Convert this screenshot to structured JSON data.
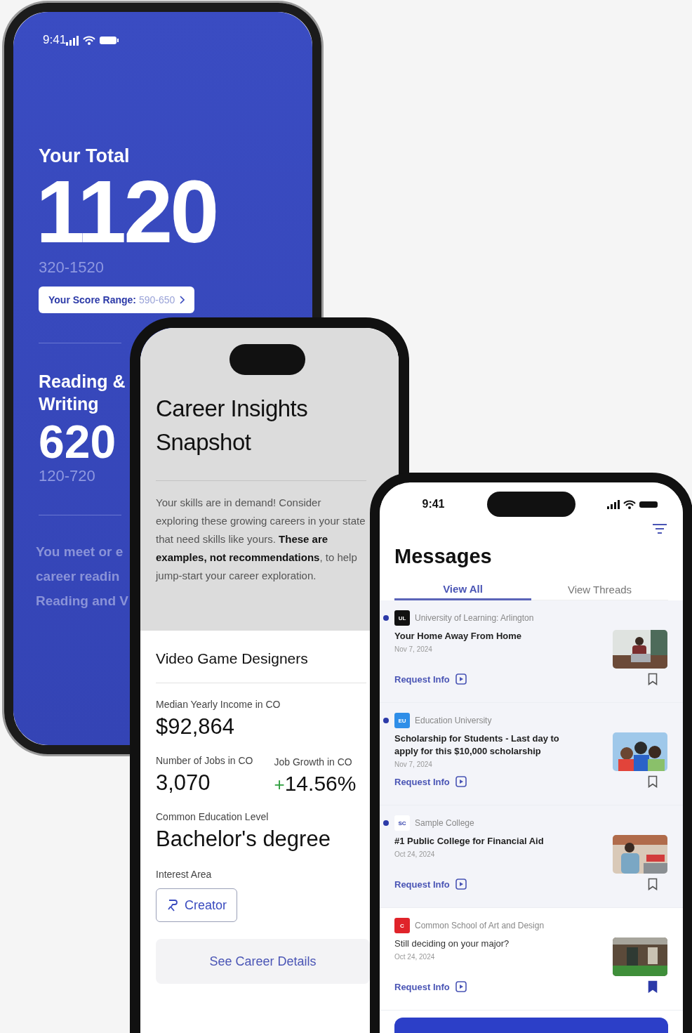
{
  "score_phone": {
    "status_time": "9:41",
    "total_label": "Your Total",
    "total": "1120",
    "total_range": "320-1520",
    "range_button": {
      "label": "Your Score Range:",
      "value": "590-650"
    },
    "section_title": "Reading & Writing",
    "section_score": "620",
    "section_range": "120-720",
    "note_lines": [
      "You meet or e",
      "career readin",
      "Reading and V"
    ]
  },
  "career_phone": {
    "title": "Career Insights Snapshot",
    "intro": "Your skills are in demand! Consider exploring these growing careers in your state that need skills like yours. **These are examples, not recommendations**, to help jump-start your career exploration.",
    "career": "Video Game Designers",
    "income_label": "Median Yearly Income in CO",
    "income": "$92,864",
    "jobs_label": "Number of Jobs in CO",
    "jobs": "3,070",
    "growth_label": "Job Growth in CO",
    "growth_sign": "+",
    "growth": "14.56%",
    "education_label": "Common Education Level",
    "education": "Bachelor's degree",
    "interest_label": "Interest Area",
    "interest": "Creator",
    "details_button": "See Career Details"
  },
  "messages_phone": {
    "status_time": "9:41",
    "title": "Messages",
    "tabs": [
      {
        "label": "View All",
        "selected": true
      },
      {
        "label": "View Threads",
        "selected": false
      }
    ],
    "messages": [
      {
        "logo": "UL",
        "color": "#111111",
        "source": "University of Learning: Arlington",
        "title": "Your Home Away From Home",
        "date": "Nov 7, 2024",
        "link": "Request Info",
        "unread": true,
        "saved": false
      },
      {
        "logo": "EU",
        "color": "#2f8ee8",
        "source": "Education University",
        "title": "Scholarship for Students - Last day to apply for this $10,000 scholarship",
        "date": "Nov 7, 2024",
        "link": "Request Info",
        "unread": true,
        "saved": false
      },
      {
        "logo": "SC",
        "color": "#ffffff",
        "source": "Sample College",
        "title": "#1 Public College for Financial Aid",
        "date": "Oct 24, 2024",
        "link": "Request Info",
        "unread": true,
        "saved": false
      },
      {
        "logo": "C",
        "color": "#e0232a",
        "source": "Common School of Art and Design",
        "title": "Still deciding on your major?",
        "date": "Oct 24, 2024",
        "link": "Request Info",
        "unread": false,
        "saved": true
      }
    ]
  }
}
